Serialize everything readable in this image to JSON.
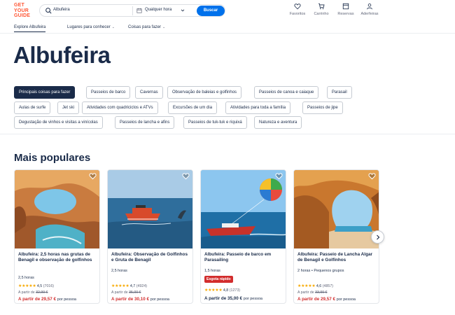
{
  "logo": [
    "GET",
    "YOUR",
    "GUIDE"
  ],
  "search": {
    "value": "Albufeira",
    "date": "Qualquer hora",
    "button": "Buscar"
  },
  "nav": [
    {
      "label": "Favoritos",
      "icon": "heart-icon"
    },
    {
      "label": "Carrinho",
      "icon": "cart-icon"
    },
    {
      "label": "Reservas",
      "icon": "ticket-icon"
    },
    {
      "label": "Aderfeiras",
      "icon": "user-icon"
    }
  ],
  "subnav": {
    "explore": "Explore Albufeira",
    "places": "Lugares para conhecer",
    "things": "Coisas para fazer"
  },
  "page_title": "Albufeira",
  "chips": [
    "Principais coisas para fazer",
    "Passeios de barco",
    "Cavernas",
    "Observação de baleias e golfinhos",
    "Passeios de canoa e caiaque",
    "Parasail",
    "Aulas de surfe",
    "Jet ski",
    "Atividades com quadriciclos e ATVs",
    "Excursões de um dia",
    "Atividades para toda a família",
    "Passeios de jipe",
    "Degustação de vinhos e visitas a vinícolas",
    "Passeios de lancha e afins",
    "Passeios de tuk-tuk e riquixá",
    "Natureza e aventura"
  ],
  "section_title": "Mais populares",
  "cards": [
    {
      "title": "Albufeira: 2,5 horas nas grutas de Benagil e observação de golfinhos",
      "meta": "2,5 horas",
      "badge": "",
      "stars": "★★★★★",
      "rating": "4,5",
      "count": "(7016)",
      "old_label": "A partir de",
      "old_price": "32,99 €",
      "price": "A partir de 29,57 €",
      "per": "por pessoa",
      "discount": true
    },
    {
      "title": "Albufeira: Observação de Golfinhos e Gruta de Benagil",
      "meta": "2,5 horas",
      "badge": "",
      "stars": "★★★★★",
      "rating": "4,7",
      "count": "(4924)",
      "old_label": "A partir de",
      "old_price": "35,00 €",
      "price": "A partir de 30,10 €",
      "per": "por pessoa",
      "discount": true
    },
    {
      "title": "Albufeira: Passeio de barco em Parasailing",
      "meta": "1,5 horas",
      "badge": "Esgota rápido",
      "stars": "★★★★★",
      "rating": "4,8",
      "count": "(1273)",
      "old_label": "",
      "old_price": "",
      "price": "A partir de 35,00 €",
      "per": "por pessoa",
      "discount": false
    },
    {
      "title": "Albufeira: Passeio de Lancha Algar de Benagil e Golfinhos",
      "meta": "2 horas • Pequenos grupos",
      "badge": "",
      "stars": "★★★★★",
      "rating": "4,6",
      "count": "(4857)",
      "old_label": "A partir de",
      "old_price": "33,99 €",
      "price": "A partir de 29,57 €",
      "per": "por pessoa",
      "discount": true
    }
  ],
  "colors": {
    "brand": "#ff5533",
    "primary": "#0071eb",
    "navy": "#1a2b49",
    "sale": "#d22d2d",
    "star": "#f7a800"
  }
}
